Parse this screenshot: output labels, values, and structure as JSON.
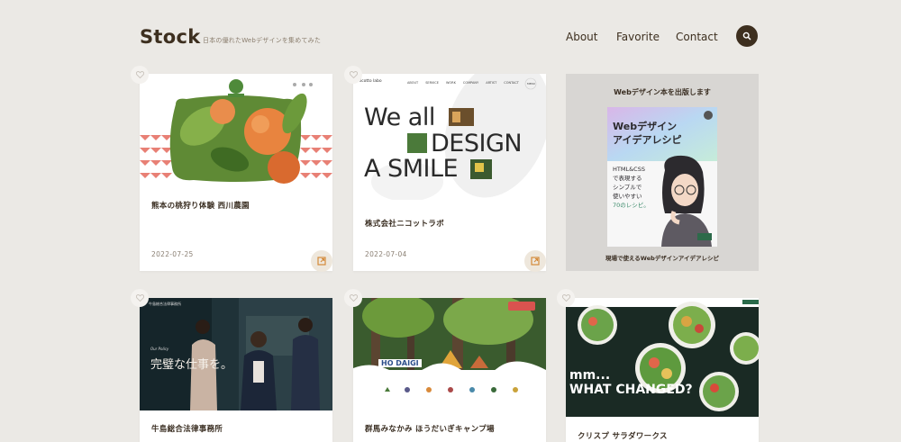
{
  "header": {
    "logo": "Stock",
    "tagline": "日本の優れたWebデザインを集めてみた",
    "nav": {
      "about": "About",
      "favorite": "Favorite",
      "contact": "Contact"
    }
  },
  "cards": [
    {
      "title": "熊本の桃狩り体験 西川農園",
      "date": "2022-07-25"
    },
    {
      "title": "株式会社ニコットラボ",
      "date": "2022-07-04",
      "hero_line1": "We all",
      "hero_line2": "DESIGN",
      "hero_line3": "A SMILE",
      "site_nav": [
        "ABOUT",
        "SERVICE",
        "WORK",
        "COMPANY",
        "ARTIST",
        "CONTACT"
      ],
      "site_logo": "nicotto labo",
      "menu": "MENU"
    },
    {
      "title": "牛島総合法律事務所",
      "hero_text": "完璧な仕事を。",
      "sub": "Our Policy",
      "firm_name": "牛島総合法律事務所"
    },
    {
      "title": "群馬みなかみ ほうだいぎキャンプ場",
      "logo_text": "HO DAIGI"
    },
    {
      "title": "クリスプ サラダワークス",
      "hero_text1": "mm...",
      "hero_text2": "WHAT CHANGED?"
    }
  ],
  "promo": {
    "heading": "Webデザイン本を出版します",
    "book_title1": "Webデザイン",
    "book_title2": "アイデアレシピ",
    "book_sub1": "HTML&CSS",
    "book_sub2": "で表現する",
    "book_sub3": "シンプルで",
    "book_sub4": "使いやすい",
    "book_sub5": "70のレシピ。",
    "footer": "現場で使えるWebデザインアイデアレシピ"
  },
  "colors": {
    "background": "#ebe9e5",
    "brand": "#3d2f1f",
    "card": "#ffffff"
  }
}
